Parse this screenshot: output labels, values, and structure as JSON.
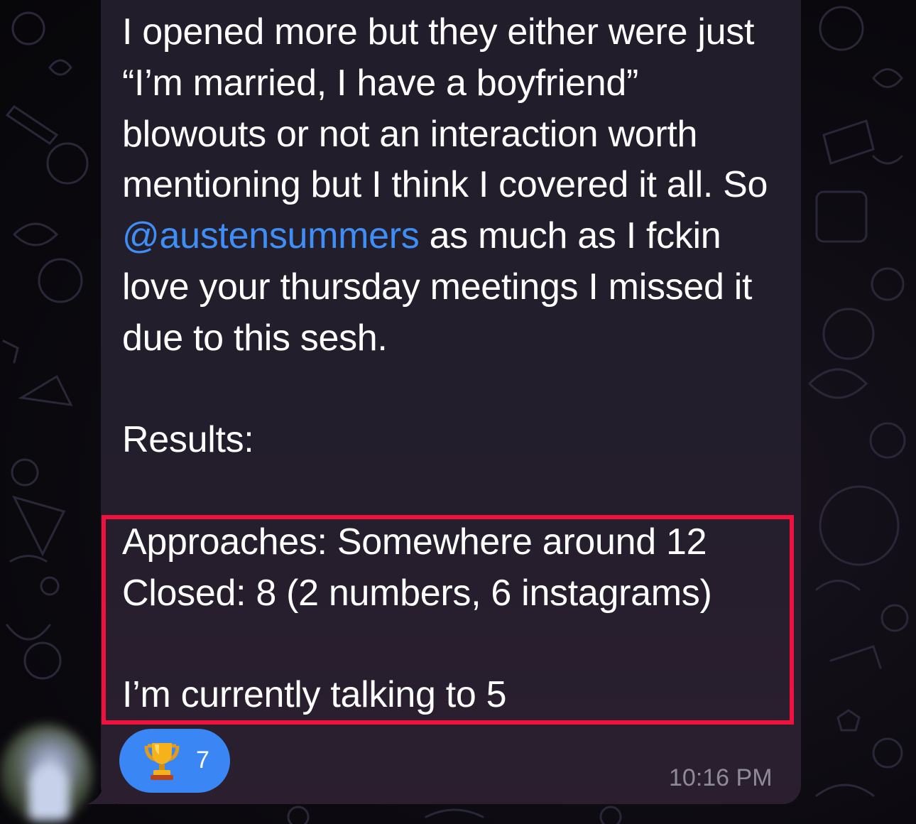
{
  "message": {
    "paragraph1_before_mention": "I opened more but they either were just “I’m married, I have a boyfriend” blowouts or not an interaction worth mentioning but I think I covered it all. So ",
    "mention": "@austensummers",
    "paragraph1_after_mention": " as much as I fckin love your thursday meetings I missed it due to this sesh.",
    "results_label": "Results:",
    "approaches_line": "Approaches: Somewhere around 12",
    "closed_line": "Closed: 8 (2 numbers, 6 instagrams)",
    "talking_line": "I’m currently talking to 5"
  },
  "reaction": {
    "icon": "trophy-icon",
    "count": "7"
  },
  "timestamp": "10:16 PM",
  "colors": {
    "bubble": "#231e2c",
    "mention": "#3f8ef5",
    "reaction": "#3a86f4",
    "highlight": "#f0123e",
    "timestamp": "#8f8a99"
  }
}
